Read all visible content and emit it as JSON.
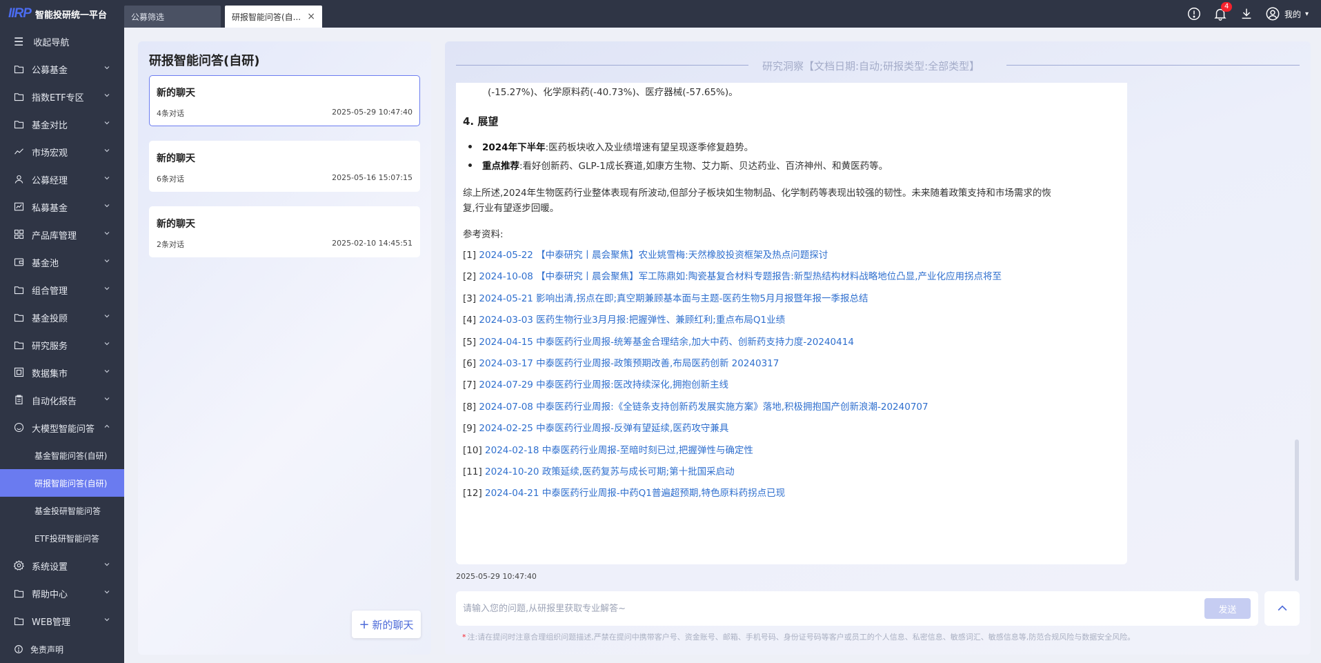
{
  "app": {
    "logo_mark": "IIRP",
    "logo_text": "智能投研统一平台",
    "tabs": [
      {
        "label": "公募筛选"
      },
      {
        "label": "研报智能问答(自..."
      }
    ],
    "notification_count": "4",
    "user_label": "我的"
  },
  "sidebar": {
    "collapse_label": "收起导航",
    "items": [
      {
        "label": "公募基金",
        "icon": "folder-icon"
      },
      {
        "label": "指数ETF专区",
        "icon": "folder-icon"
      },
      {
        "label": "基金对比",
        "icon": "folder-icon"
      },
      {
        "label": "市场宏观",
        "icon": "trend-icon"
      },
      {
        "label": "公募经理",
        "icon": "person-icon"
      },
      {
        "label": "私募基金",
        "icon": "chart-icon"
      },
      {
        "label": "产品库管理",
        "icon": "grid-icon"
      },
      {
        "label": "基金池",
        "icon": "wallet-icon"
      },
      {
        "label": "组合管理",
        "icon": "folder-icon"
      },
      {
        "label": "基金投顾",
        "icon": "folder-icon"
      },
      {
        "label": "研究服务",
        "icon": "folder-icon"
      },
      {
        "label": "数据集市",
        "icon": "database-icon"
      },
      {
        "label": "自动化报告",
        "icon": "clipboard-icon"
      },
      {
        "label": "大模型智能问答",
        "icon": "smile-icon"
      }
    ],
    "subitems": [
      {
        "label": "基金智能问答(自研)"
      },
      {
        "label": "研报智能问答(自研)"
      },
      {
        "label": "基金投研智能问答"
      },
      {
        "label": "ETF投研智能问答"
      }
    ],
    "bottom_items": [
      {
        "label": "系统设置",
        "icon": "gear-icon"
      },
      {
        "label": "帮助中心",
        "icon": "folder-icon"
      },
      {
        "label": "WEB管理",
        "icon": "folder-icon"
      }
    ],
    "disclaimer_label": "免责声明"
  },
  "chat_panel": {
    "title": "研报智能问答(自研)",
    "chats": [
      {
        "name": "新的聊天",
        "count": "4条对话",
        "time": "2025-05-29 10:47:40"
      },
      {
        "name": "新的聊天",
        "count": "6条对话",
        "time": "2025-05-16 15:07:15"
      },
      {
        "name": "新的聊天",
        "count": "2条对话",
        "time": "2025-02-10 14:45:51"
      }
    ],
    "new_chat_label": "新的聊天"
  },
  "main": {
    "header": "研究洞察【文档日期:自动;研报类型:全部类型】",
    "partial_line": "(-15.27%)、化学原料药(-40.73%)、医疗器械(-57.65%)。",
    "section_title": "4. 展望",
    "bullets": [
      {
        "bold": "2024年下半年",
        "text": ":医药板块收入及业绩增速有望呈现逐季修复趋势。"
      },
      {
        "bold": "重点推荐",
        "text": ":看好创新药、GLP-1成长赛道,如康方生物、艾力斯、贝达药业、百济神州、和黄医药等。"
      }
    ],
    "summary_line1": "综上所述,2024年生物医药行业整体表现有所波动,但部分子板块如生物制品、化学制药等表现出较强的韧性。未来随着政策支持和市场需求的恢",
    "summary_line2": "复,行业有望逐步回暖。",
    "references_label": "参考资料:",
    "references": [
      {
        "num": "[1]",
        "text": "2024-05-22 【中泰研究丨晨会聚焦】农业姚雪梅:天然橡胶投资框架及热点问题探讨"
      },
      {
        "num": "[2]",
        "text": "2024-10-08 【中泰研究丨晨会聚焦】军工陈鼎如:陶瓷基复合材料专题报告:新型热结构材料战略地位凸显,产业化应用拐点将至"
      },
      {
        "num": "[3]",
        "text": "2024-05-21 影响出清,拐点在即;真空期兼顾基本面与主题-医药生物5月月报暨年报一季报总结"
      },
      {
        "num": "[4]",
        "text": "2024-03-03 医药生物行业3月月报:把握弹性、兼顾红利;重点布局Q1业绩"
      },
      {
        "num": "[5]",
        "text": "2024-04-15 中泰医药行业周报-统筹基金合理结余,加大中药、创新药支持力度-20240414"
      },
      {
        "num": "[6]",
        "text": "2024-03-17 中泰医药行业周报-政策预期改善,布局医药创新 20240317"
      },
      {
        "num": "[7]",
        "text": "2024-07-29 中泰医药行业周报:医改持续深化,拥抱创新主线"
      },
      {
        "num": "[8]",
        "text": "2024-07-08 中泰医药行业周报:《全链条支持创新药发展实施方案》落地,积极拥抱国产创新浪潮-20240707"
      },
      {
        "num": "[9]",
        "text": "2024-02-25 中泰医药行业周报-反弹有望延续,医药攻守兼具"
      },
      {
        "num": "[10]",
        "text": "2024-02-18 中泰医药行业周报-至暗时刻已过,把握弹性与确定性"
      },
      {
        "num": "[11]",
        "text": "2024-10-20 政策延续,医药复苏与成长可期;第十批国采启动"
      },
      {
        "num": "[12]",
        "text": "2024-04-21 中泰医药行业周报-中药Q1普遍超预期,特色原料药拐点已现"
      }
    ],
    "message_time": "2025-05-29 10:47:40",
    "input_placeholder": "请输入您的问题,从研报里获取专业解答~",
    "send_label": "发送",
    "notice": "注:请在提问时注意合理组织问题描述,严禁在提问中携带客户号、资金账号、邮箱、手机号码、身份证号码等客户或员工的个人信息、私密信息、敏感词汇、敏感信息等,防范合规风险与数据安全风险。"
  }
}
